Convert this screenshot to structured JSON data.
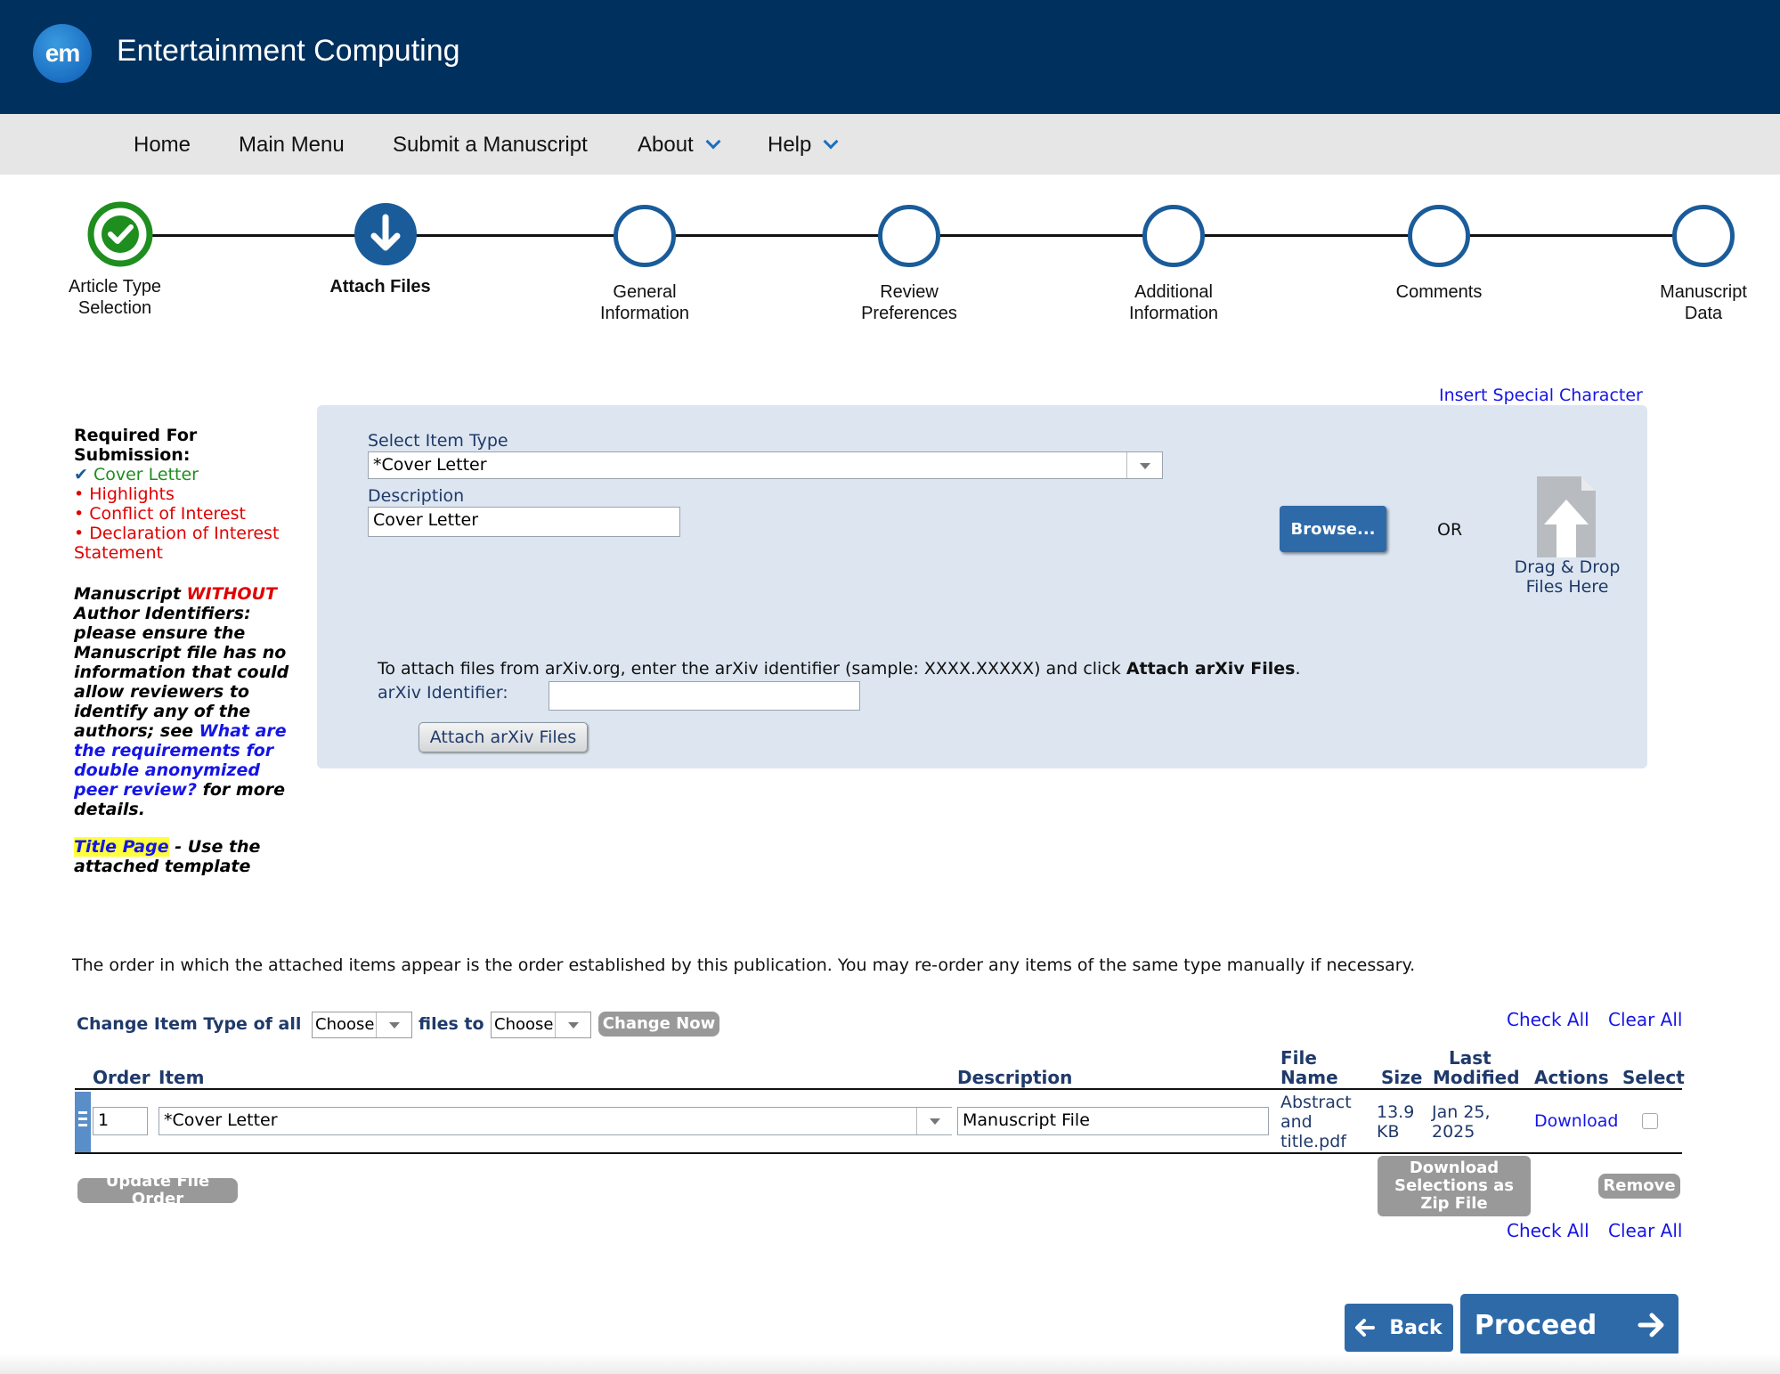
{
  "header": {
    "logo_text": "em",
    "title": "Entertainment Computing"
  },
  "nav": {
    "items": [
      {
        "label": "Home"
      },
      {
        "label": "Main Menu"
      },
      {
        "label": "Submit a Manuscript"
      },
      {
        "label": "About"
      },
      {
        "label": "Help"
      }
    ]
  },
  "steps": [
    {
      "label_line1": "Article Type",
      "label_line2": "Selection",
      "state": "complete"
    },
    {
      "label_line1": "Attach Files",
      "label_line2": "",
      "state": "current"
    },
    {
      "label_line1": "General",
      "label_line2": "Information",
      "state": "pending"
    },
    {
      "label_line1": "Review",
      "label_line2": "Preferences",
      "state": "pending"
    },
    {
      "label_line1": "Additional",
      "label_line2": "Information",
      "state": "pending"
    },
    {
      "label_line1": "Comments",
      "label_line2": "",
      "state": "pending"
    },
    {
      "label_line1": "Manuscript",
      "label_line2": "Data",
      "state": "pending"
    }
  ],
  "requirements": {
    "title": "Required For Submission:",
    "satisfied": [
      "Cover Letter"
    ],
    "missing": [
      "Highlights",
      "Conflict of Interest",
      "Declaration of Interest Statement"
    ]
  },
  "anonymity_note": {
    "prefix": "Manuscript ",
    "emphasis": "WITHOUT",
    "body": " Author Identifiers: please ensure the Manuscript file has no information that could allow reviewers to identify any of the authors; see ",
    "link": "What are the requirements for double anonymized peer review?",
    "suffix": " for more details."
  },
  "title_page_note": {
    "link": "Title Page",
    "text": " - Use the attached template"
  },
  "upload": {
    "insert_special_char": "Insert Special Character",
    "item_type_label": "Select Item Type",
    "item_type_value": "*Cover Letter",
    "description_label": "Description",
    "description_value": "Cover Letter",
    "browse_label": "Browse...",
    "or_label": "OR",
    "drag_drop_line1": "Drag & Drop",
    "drag_drop_line2": "Files Here",
    "arxiv_instruction": "To attach files from arXiv.org, enter the arXiv identifier (sample: XXXX.XXXXX) and click ",
    "arxiv_instruction_bold": "Attach arXiv Files",
    "arxiv_instruction_end": ".",
    "arxiv_label": "arXiv Identifier:",
    "arxiv_value": "",
    "arxiv_button": "Attach arXiv Files"
  },
  "order_notice": "The order in which the attached items appear is the order established by this publication. You may re-order any items of the same type manually if necessary.",
  "bulk_change": {
    "label1": "Change Item Type of all",
    "from_value": "Choose",
    "label2": "files to",
    "to_value": "Choose",
    "button": "Change Now"
  },
  "check_all": "Check All",
  "clear_all": "Clear All",
  "table": {
    "headers": {
      "order": "Order",
      "item": "Item",
      "description": "Description",
      "file_name_1": "File",
      "file_name_2": "Name",
      "size": "Size",
      "last_modified_1": "Last",
      "last_modified_2": "Modified",
      "actions": "Actions",
      "select": "Select"
    },
    "rows": [
      {
        "order": "1",
        "item": "*Cover Letter",
        "description": "Manuscript File",
        "file_name_1": "Abstract",
        "file_name_2": "and",
        "file_name_3": "title.pdf",
        "size_1": "13.9",
        "size_2": "KB",
        "modified_1": "Jan 25,",
        "modified_2": "2025",
        "action": "Download",
        "selected": false
      }
    ]
  },
  "buttons": {
    "update_order": "Update File Order",
    "download_zip_1": "Download",
    "download_zip_2": "Selections as",
    "download_zip_3": "Zip File",
    "remove": "Remove",
    "back": "Back",
    "proceed": "Proceed"
  },
  "colors": {
    "header_bg": "#00305e",
    "accent": "#2f6aa8",
    "complete": "#1e8e1e",
    "missing": "#e00000",
    "link": "#1515e6"
  }
}
